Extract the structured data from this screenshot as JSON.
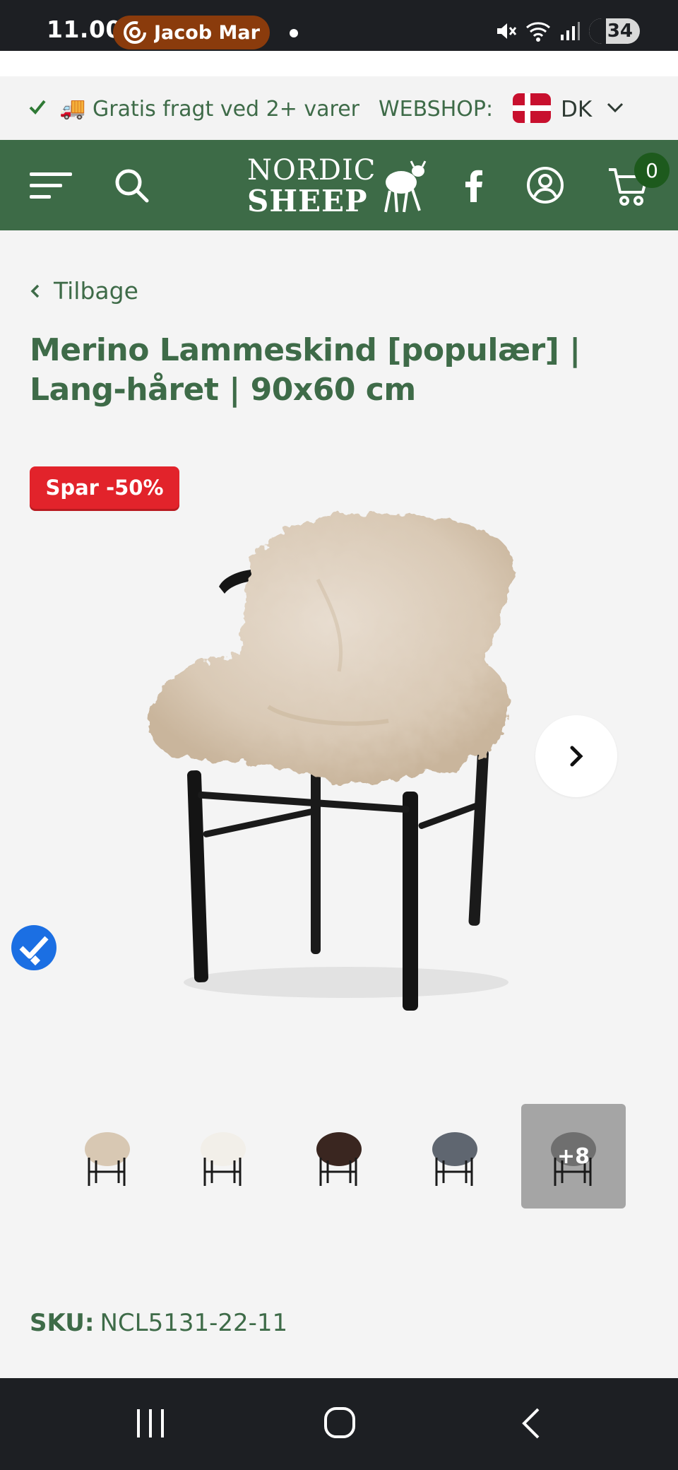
{
  "status_bar": {
    "time": "11.00",
    "caller_name": "Jacob Mark",
    "battery": "34"
  },
  "promo": {
    "shipping_text": "Gratis fragt ved 2+ varer",
    "webshop_label": "WEBSHOP:",
    "country": "DK"
  },
  "nav": {
    "logo_line1": "NORDIC",
    "logo_line2": "SHEEP",
    "cart_count": "0"
  },
  "product": {
    "back_label": "Tilbage",
    "title": "Merino Lammeskind [populær] | Lang-håret | 90x60 cm",
    "sale_badge": "Spar -50%",
    "thumbnails": [
      {
        "color": "#d8c8b3"
      },
      {
        "color": "#f2efe9"
      },
      {
        "color": "#3a2620"
      },
      {
        "color": "#5f6670"
      },
      {
        "color": "#6f6f6f",
        "more_label": "+8"
      }
    ],
    "sku_label": "SKU:",
    "sku_value": "NCL5131-22-11"
  },
  "colors": {
    "brand_green": "#3d6b47",
    "sale_red": "#e2232b",
    "cart_badge": "#1d5a1d"
  }
}
